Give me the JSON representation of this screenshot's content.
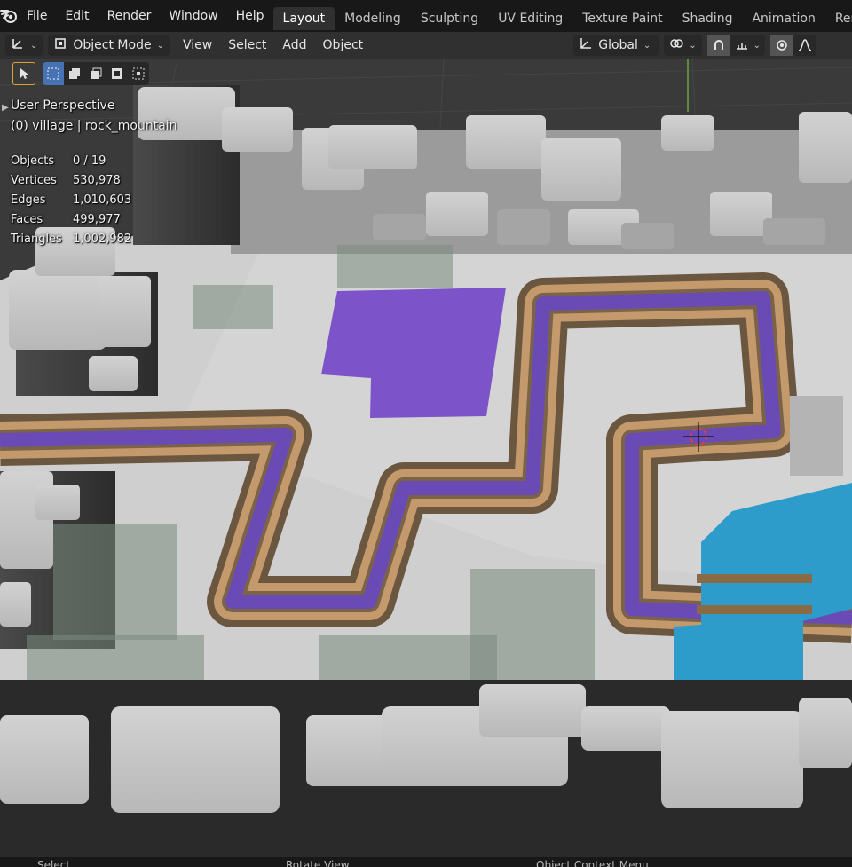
{
  "menubar": {
    "items": [
      "File",
      "Edit",
      "Render",
      "Window",
      "Help"
    ],
    "workspaces": [
      "Layout",
      "Modeling",
      "Sculpting",
      "UV Editing",
      "Texture Paint",
      "Shading",
      "Animation",
      "Ren"
    ],
    "active_workspace": "Layout"
  },
  "header": {
    "editor_type_icon": "axes-icon",
    "mode_label": "Object Mode",
    "menus": [
      "View",
      "Select",
      "Add",
      "Object"
    ],
    "orientation_label": "Global"
  },
  "viewport": {
    "perspective_label": "User Perspective",
    "collection_label": "(0) village | rock_mountain",
    "stats": [
      {
        "label": "Objects",
        "value": "0 / 19"
      },
      {
        "label": "Vertices",
        "value": "530,978"
      },
      {
        "label": "Edges",
        "value": "1,010,603"
      },
      {
        "label": "Faces",
        "value": "499,977"
      },
      {
        "label": "Triangles",
        "value": "1,002,982"
      }
    ],
    "colors": {
      "ground": "#cfcfcf",
      "rock": "#bdbdbd",
      "path_outer": "#6b5640",
      "path_tan": "#c49a6c",
      "path_purple": "#6a4bb5",
      "field_purple": "#7c53c8",
      "water": "#2e9ccb"
    }
  },
  "statusbar": {
    "items": [
      "Select",
      "Rotate View",
      "Object Context Menu"
    ]
  }
}
